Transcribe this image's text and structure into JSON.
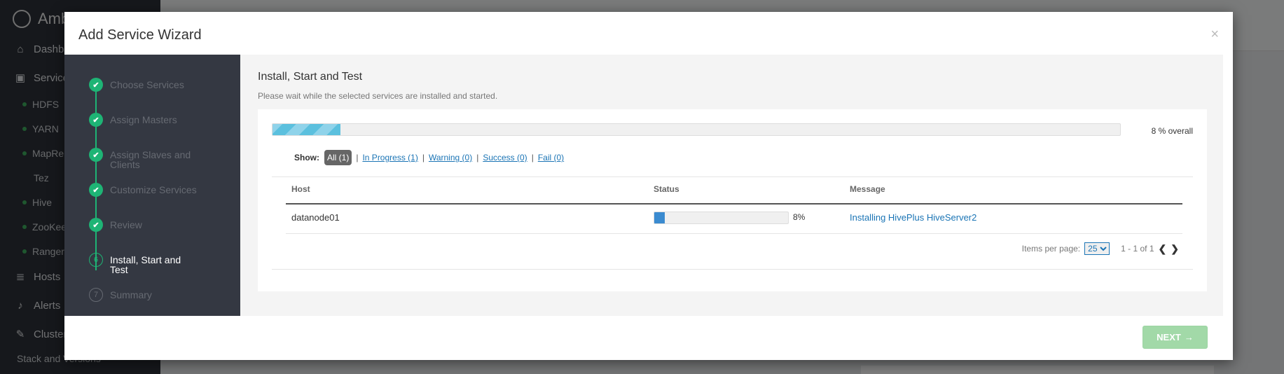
{
  "background": {
    "brand": "Amb",
    "nav": [
      "Dashbo",
      "Service",
      "Hosts",
      "Alerts",
      "Cluster"
    ],
    "services": [
      "HDFS",
      "YARN",
      "MapRe",
      "Tez",
      "Hive",
      "ZooKee",
      "Ranger"
    ],
    "stack_link": "Stack and Versions"
  },
  "modal": {
    "title": "Add Service Wizard",
    "close": "×"
  },
  "steps": [
    {
      "label": "Choose Services",
      "state": "done",
      "marker": "✔"
    },
    {
      "label": "Assign Masters",
      "state": "done",
      "marker": "✔"
    },
    {
      "label": "Assign Slaves and Clients",
      "state": "done",
      "marker": "✔"
    },
    {
      "label": "Customize Services",
      "state": "done",
      "marker": "✔"
    },
    {
      "label": "Review",
      "state": "done",
      "marker": "✔"
    },
    {
      "label": "Install, Start and Test",
      "state": "current",
      "marker": "6"
    },
    {
      "label": "Summary",
      "state": "todo",
      "marker": "7"
    }
  ],
  "content": {
    "title": "Install, Start and Test",
    "description": "Please wait while the selected services are installed and started.",
    "overall_progress": 8,
    "overall_text": "8 % overall"
  },
  "filters": {
    "show_label": "Show:",
    "all": "All (1)",
    "in_progress": "In Progress (1)",
    "warning": "Warning (0)",
    "success": "Success (0)",
    "fail": "Fail (0)",
    "separator": "|"
  },
  "table": {
    "headers": {
      "host": "Host",
      "status": "Status",
      "message": "Message"
    },
    "rows": [
      {
        "host": "datanode01",
        "progress": 8,
        "percent": "8%",
        "message": "Installing HivePlus HiveServer2"
      }
    ]
  },
  "pager": {
    "items_label": "Items per page:",
    "page_size": "25",
    "range": "1 - 1 of 1",
    "prev": "❮",
    "next": "❯"
  },
  "footer": {
    "next_label": "NEXT",
    "next_arrow": "→"
  },
  "colors": {
    "success_green": "#1eb475",
    "link_blue": "#1a74b5",
    "progress_blue": "#3b8bd0",
    "next_button": "#a2d9a8"
  }
}
